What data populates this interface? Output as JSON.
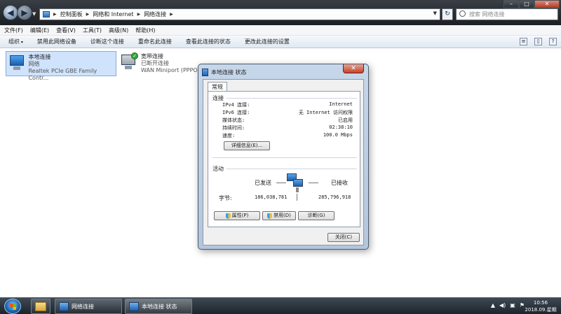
{
  "explorer": {
    "address": {
      "crumbs": [
        "控制面板",
        "网络和 Internet",
        "网络连接"
      ]
    },
    "search_placeholder": "搜索 网络连接",
    "menu": [
      "文件(F)",
      "编辑(E)",
      "查看(V)",
      "工具(T)",
      "高级(N)",
      "帮助(H)"
    ],
    "toolbar": [
      "组织",
      "禁用此网络设备",
      "诊断这个连接",
      "重命名此连接",
      "查看此连接的状态",
      "更改此连接的设置"
    ],
    "items": [
      {
        "name": "本地连接",
        "status": "网络",
        "device": "Realtek PCIe GBE Family Contr...",
        "icon": "network-pc-icon"
      },
      {
        "name": "宽带连接",
        "status": "已断开连接",
        "device": "WAN Miniport (PPPOE)",
        "icon": "dialup-pc-icon"
      }
    ]
  },
  "dialog": {
    "title": "本地连接 状态",
    "close_glyph": "✕",
    "tab": "常规",
    "connection": {
      "heading": "连接",
      "rows": [
        {
          "label": "IPv4 连接:",
          "value": "Internet"
        },
        {
          "label": "IPv6 连接:",
          "value": "无 Internet 访问权限"
        },
        {
          "label": "媒体状态:",
          "value": "已启用"
        },
        {
          "label": "持续时间:",
          "value": "02:38:10"
        },
        {
          "label": "速度:",
          "value": "100.0 Mbps"
        }
      ],
      "details_button": "详细信息(E)..."
    },
    "activity": {
      "heading": "活动",
      "sent_label": "已发送",
      "received_label": "已接收",
      "bytes_label": "字节:",
      "sent_bytes": "186,038,781",
      "received_bytes": "285,796,918"
    },
    "buttons": {
      "properties": "属性(P)",
      "disable": "禁用(D)",
      "diagnose": "诊断(G)",
      "close": "关闭(C)"
    }
  },
  "taskbar": {
    "items": [
      {
        "label": "网络连接"
      },
      {
        "label": "本地连接 状态"
      }
    ],
    "time": "10:56",
    "date": "2018.09.星期一",
    "tray_icons": [
      "chevron-up-icon",
      "volume-icon",
      "network-icon",
      "flag-icon"
    ]
  },
  "colors": {
    "titlebar": "#1c1f23",
    "dialog_frame": "#b3c6dc",
    "taskbar": "#1d242b",
    "selection": "#cfe3fc"
  }
}
